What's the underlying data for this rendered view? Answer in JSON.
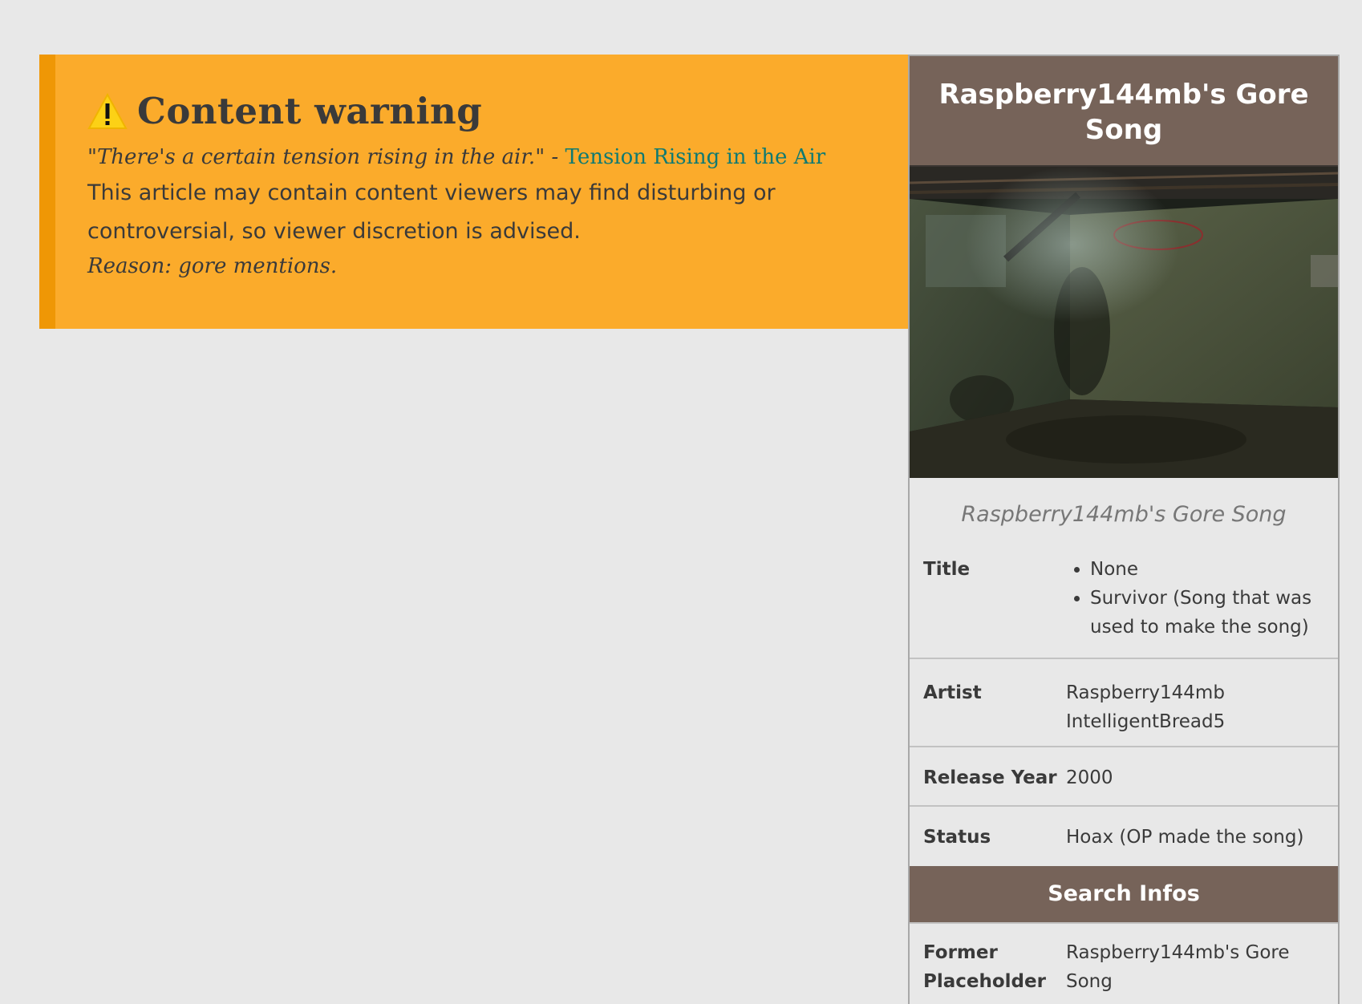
{
  "warning": {
    "icon": "warning-triangle-icon",
    "title": "Content warning",
    "quote": "\"There's a certain tension rising in the air.\"",
    "quote_separator": " - ",
    "quote_link": "Tension Rising in the Air",
    "body": "This article may contain content viewers may find disturbing or controversial, so viewer discretion is advised.",
    "reason": "Reason: gore mentions.",
    "colors": {
      "background": "#fbab2b",
      "border": "#ef9705",
      "link": "#0f7a72"
    }
  },
  "infobox": {
    "title": "Raspberry144mb's Gore Song",
    "caption": "Raspberry144mb's Gore Song",
    "rows": {
      "title": {
        "label": "Title",
        "values": [
          "None",
          "Survivor (Song that was used to make the song)"
        ]
      },
      "artist": {
        "label": "Artist",
        "values": [
          "Raspberry144mb",
          "IntelligentBread5"
        ]
      },
      "release_year": {
        "label": "Release Year",
        "value": "2000"
      },
      "status": {
        "label": "Status",
        "value": "Hoax (OP made the song)"
      }
    },
    "section": "Search Infos",
    "former_placeholder": {
      "label": "Former Placeholder",
      "value": "Raspberry144mb's Gore Song"
    },
    "colors": {
      "header": "#766359"
    }
  }
}
